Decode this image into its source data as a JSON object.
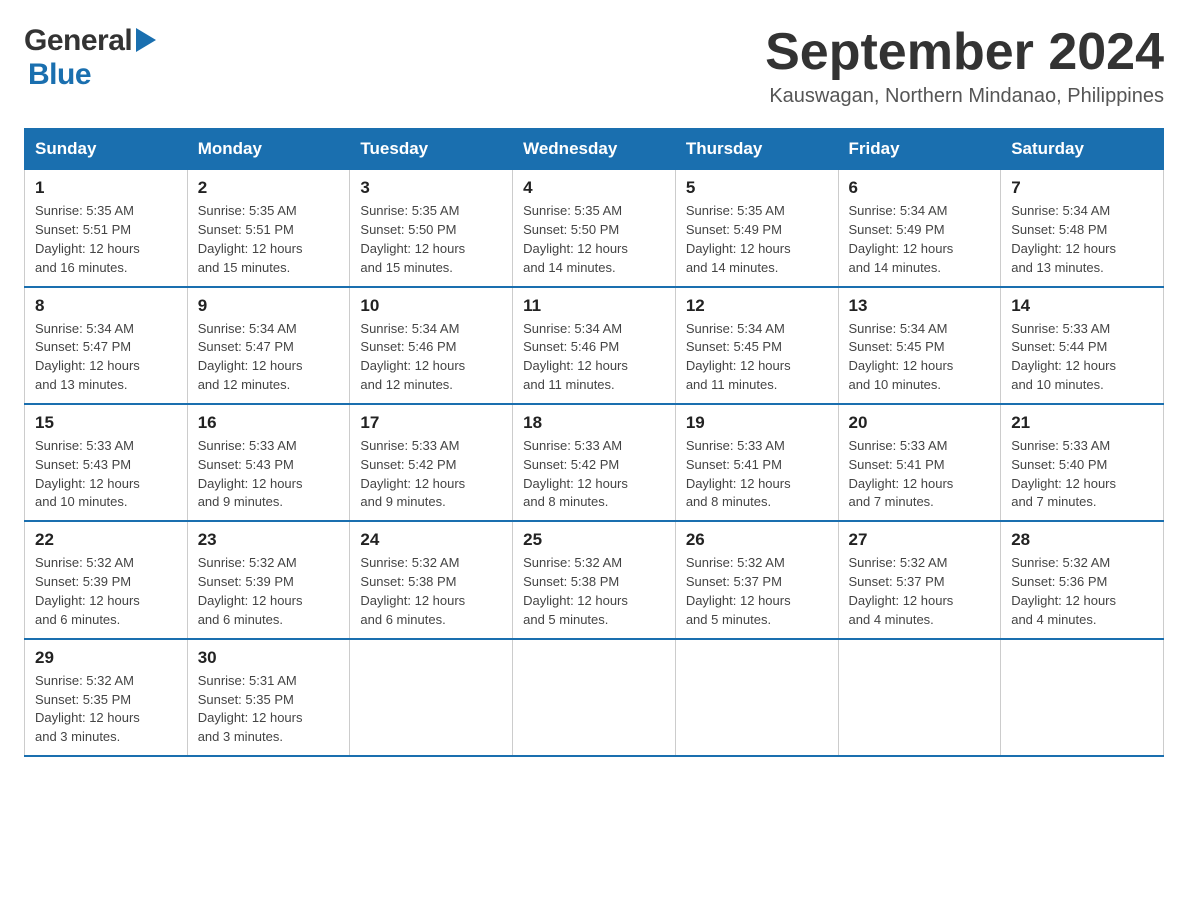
{
  "header": {
    "logo_general": "General",
    "logo_blue": "Blue",
    "month_title": "September 2024",
    "location": "Kauswagan, Northern Mindanao, Philippines"
  },
  "weekdays": [
    "Sunday",
    "Monday",
    "Tuesday",
    "Wednesday",
    "Thursday",
    "Friday",
    "Saturday"
  ],
  "weeks": [
    [
      {
        "day": "1",
        "sunrise": "5:35 AM",
        "sunset": "5:51 PM",
        "daylight": "12 hours and 16 minutes."
      },
      {
        "day": "2",
        "sunrise": "5:35 AM",
        "sunset": "5:51 PM",
        "daylight": "12 hours and 15 minutes."
      },
      {
        "day": "3",
        "sunrise": "5:35 AM",
        "sunset": "5:50 PM",
        "daylight": "12 hours and 15 minutes."
      },
      {
        "day": "4",
        "sunrise": "5:35 AM",
        "sunset": "5:50 PM",
        "daylight": "12 hours and 14 minutes."
      },
      {
        "day": "5",
        "sunrise": "5:35 AM",
        "sunset": "5:49 PM",
        "daylight": "12 hours and 14 minutes."
      },
      {
        "day": "6",
        "sunrise": "5:34 AM",
        "sunset": "5:49 PM",
        "daylight": "12 hours and 14 minutes."
      },
      {
        "day": "7",
        "sunrise": "5:34 AM",
        "sunset": "5:48 PM",
        "daylight": "12 hours and 13 minutes."
      }
    ],
    [
      {
        "day": "8",
        "sunrise": "5:34 AM",
        "sunset": "5:47 PM",
        "daylight": "12 hours and 13 minutes."
      },
      {
        "day": "9",
        "sunrise": "5:34 AM",
        "sunset": "5:47 PM",
        "daylight": "12 hours and 12 minutes."
      },
      {
        "day": "10",
        "sunrise": "5:34 AM",
        "sunset": "5:46 PM",
        "daylight": "12 hours and 12 minutes."
      },
      {
        "day": "11",
        "sunrise": "5:34 AM",
        "sunset": "5:46 PM",
        "daylight": "12 hours and 11 minutes."
      },
      {
        "day": "12",
        "sunrise": "5:34 AM",
        "sunset": "5:45 PM",
        "daylight": "12 hours and 11 minutes."
      },
      {
        "day": "13",
        "sunrise": "5:34 AM",
        "sunset": "5:45 PM",
        "daylight": "12 hours and 10 minutes."
      },
      {
        "day": "14",
        "sunrise": "5:33 AM",
        "sunset": "5:44 PM",
        "daylight": "12 hours and 10 minutes."
      }
    ],
    [
      {
        "day": "15",
        "sunrise": "5:33 AM",
        "sunset": "5:43 PM",
        "daylight": "12 hours and 10 minutes."
      },
      {
        "day": "16",
        "sunrise": "5:33 AM",
        "sunset": "5:43 PM",
        "daylight": "12 hours and 9 minutes."
      },
      {
        "day": "17",
        "sunrise": "5:33 AM",
        "sunset": "5:42 PM",
        "daylight": "12 hours and 9 minutes."
      },
      {
        "day": "18",
        "sunrise": "5:33 AM",
        "sunset": "5:42 PM",
        "daylight": "12 hours and 8 minutes."
      },
      {
        "day": "19",
        "sunrise": "5:33 AM",
        "sunset": "5:41 PM",
        "daylight": "12 hours and 8 minutes."
      },
      {
        "day": "20",
        "sunrise": "5:33 AM",
        "sunset": "5:41 PM",
        "daylight": "12 hours and 7 minutes."
      },
      {
        "day": "21",
        "sunrise": "5:33 AM",
        "sunset": "5:40 PM",
        "daylight": "12 hours and 7 minutes."
      }
    ],
    [
      {
        "day": "22",
        "sunrise": "5:32 AM",
        "sunset": "5:39 PM",
        "daylight": "12 hours and 6 minutes."
      },
      {
        "day": "23",
        "sunrise": "5:32 AM",
        "sunset": "5:39 PM",
        "daylight": "12 hours and 6 minutes."
      },
      {
        "day": "24",
        "sunrise": "5:32 AM",
        "sunset": "5:38 PM",
        "daylight": "12 hours and 6 minutes."
      },
      {
        "day": "25",
        "sunrise": "5:32 AM",
        "sunset": "5:38 PM",
        "daylight": "12 hours and 5 minutes."
      },
      {
        "day": "26",
        "sunrise": "5:32 AM",
        "sunset": "5:37 PM",
        "daylight": "12 hours and 5 minutes."
      },
      {
        "day": "27",
        "sunrise": "5:32 AM",
        "sunset": "5:37 PM",
        "daylight": "12 hours and 4 minutes."
      },
      {
        "day": "28",
        "sunrise": "5:32 AM",
        "sunset": "5:36 PM",
        "daylight": "12 hours and 4 minutes."
      }
    ],
    [
      {
        "day": "29",
        "sunrise": "5:32 AM",
        "sunset": "5:35 PM",
        "daylight": "12 hours and 3 minutes."
      },
      {
        "day": "30",
        "sunrise": "5:31 AM",
        "sunset": "5:35 PM",
        "daylight": "12 hours and 3 minutes."
      },
      null,
      null,
      null,
      null,
      null
    ]
  ],
  "labels": {
    "sunrise": "Sunrise:",
    "sunset": "Sunset:",
    "daylight": "Daylight:"
  }
}
